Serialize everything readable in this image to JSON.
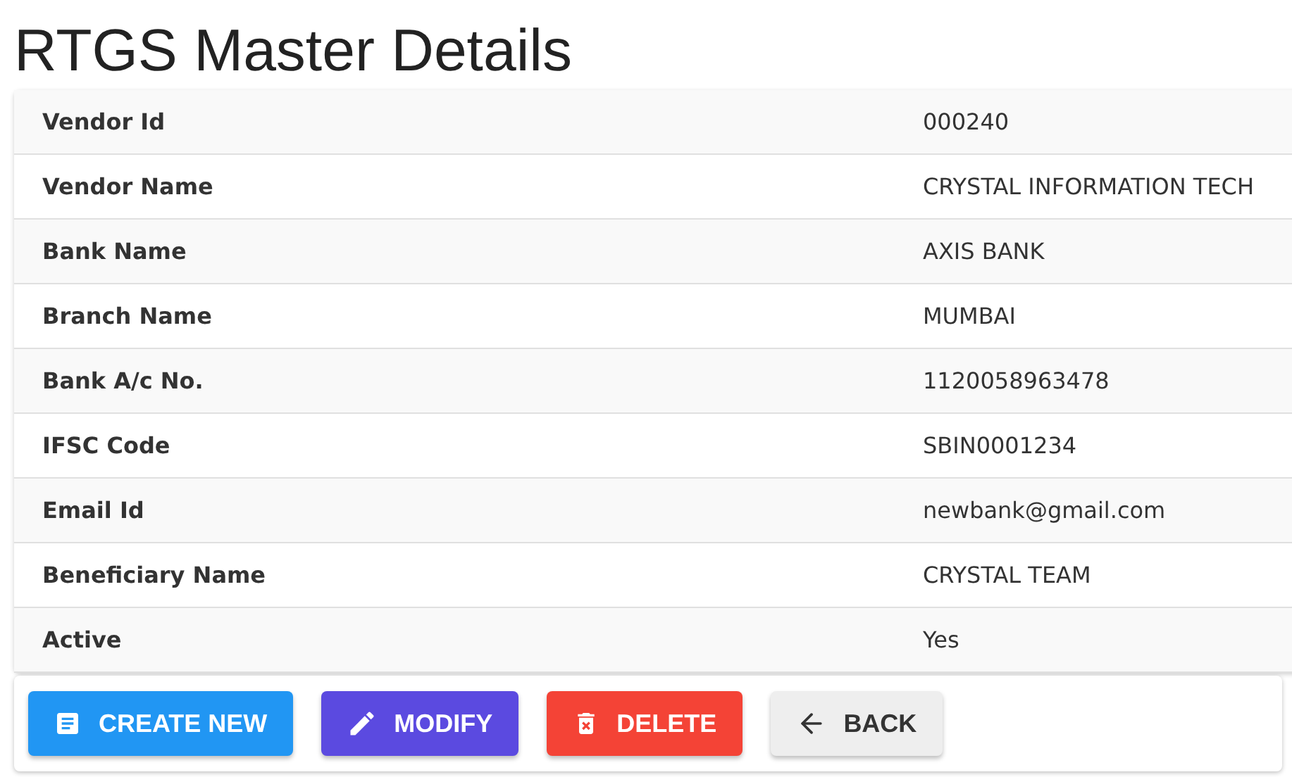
{
  "title": "RTGS Master Details",
  "rows": [
    {
      "label": "Vendor Id",
      "value": "000240"
    },
    {
      "label": "Vendor Name",
      "value": "CRYSTAL INFORMATION TECH"
    },
    {
      "label": "Bank Name",
      "value": "AXIS BANK"
    },
    {
      "label": "Branch Name",
      "value": "MUMBAI"
    },
    {
      "label": "Bank A/c No.",
      "value": "1120058963478"
    },
    {
      "label": "IFSC Code",
      "value": "SBIN0001234"
    },
    {
      "label": "Email Id",
      "value": "newbank@gmail.com"
    },
    {
      "label": "Beneficiary Name",
      "value": "CRYSTAL TEAM"
    },
    {
      "label": "Active",
      "value": "Yes"
    }
  ],
  "buttons": [
    {
      "kind": "create",
      "label": "CREATE NEW"
    },
    {
      "kind": "modify",
      "label": "MODIFY"
    },
    {
      "kind": "delete",
      "label": "DELETE"
    },
    {
      "kind": "back",
      "label": "BACK"
    }
  ]
}
